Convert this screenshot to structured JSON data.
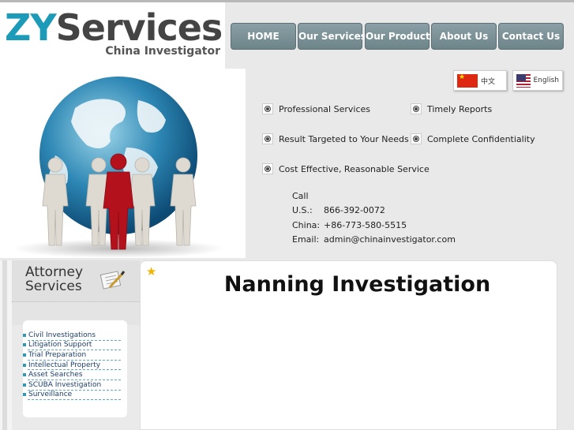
{
  "brand": {
    "name_part1": "ZY",
    "name_part2": "Services",
    "tagline": "China Investigator",
    "colors": {
      "accent": "#1c9bb8",
      "nav": "#7a9196"
    }
  },
  "nav": [
    {
      "label": "HOME"
    },
    {
      "label": "Our Services"
    },
    {
      "label": "Our Product"
    },
    {
      "label": "About Us"
    },
    {
      "label": "Contact Us"
    }
  ],
  "languages": {
    "chinese": "中文",
    "english": "English"
  },
  "features": [
    "Professional Services",
    "Timely Reports",
    "Result Targeted to Your Needs",
    "Complete Confidentiality",
    "Cost Effective, Reasonable Service"
  ],
  "contact": {
    "heading": "Call",
    "rows": [
      {
        "label": "U.S.:",
        "value": "866-392-0072"
      },
      {
        "label": "China:",
        "value": "+86-773-580-5515"
      },
      {
        "label": "Email:",
        "value": "admin@chinainvestigator.com"
      }
    ]
  },
  "sidebar": {
    "title_line1": "Attorney",
    "title_line2": "Services",
    "items": [
      "Civil Investigations",
      "Litigation Support",
      "Trial Preparation",
      "Intellectual Property",
      "Asset Searches",
      "SCUBA Investigation",
      "Surveillance"
    ]
  },
  "main": {
    "title": "Nanning Investigation"
  }
}
